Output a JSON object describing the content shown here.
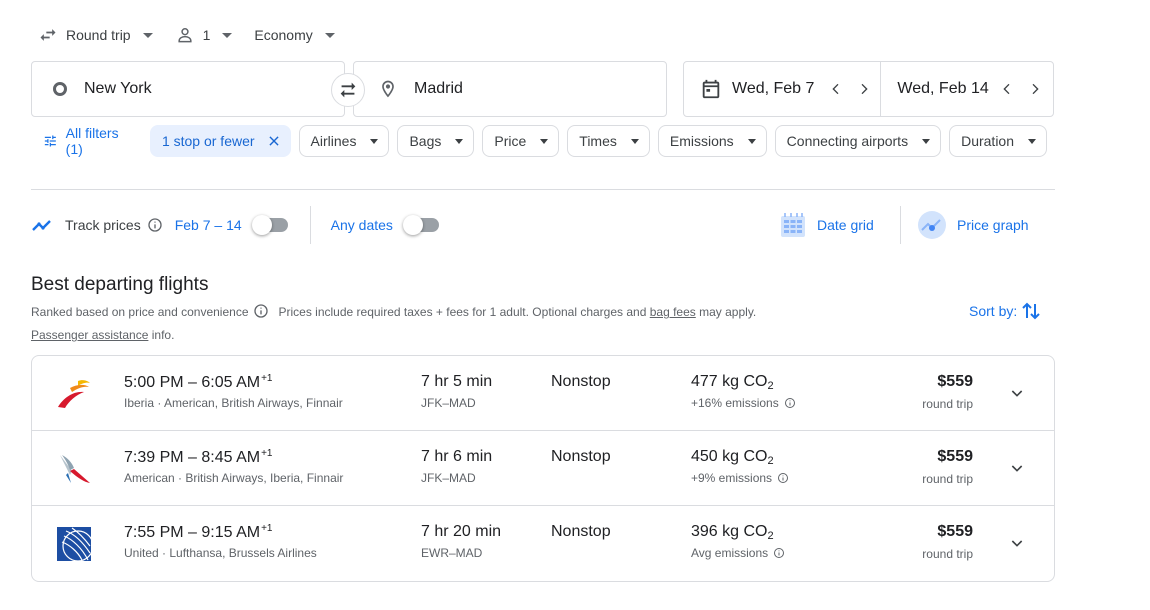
{
  "top": {
    "trip_type": "Round trip",
    "passengers": "1",
    "cabin": "Economy"
  },
  "search": {
    "origin": "New York",
    "destination": "Madrid",
    "depart_date": "Wed, Feb 7",
    "return_date": "Wed, Feb 14"
  },
  "filters": {
    "all_filters": "All filters (1)",
    "active_chip": "1 stop or fewer",
    "chips": [
      "Airlines",
      "Bags",
      "Price",
      "Times",
      "Emissions",
      "Connecting airports",
      "Duration"
    ]
  },
  "track": {
    "label": "Track prices",
    "dates": "Feb 7 – 14",
    "any_dates": "Any dates",
    "date_grid": "Date grid",
    "price_graph": "Price graph"
  },
  "results": {
    "title": "Best departing flights",
    "ranked": "Ranked based on price and convenience",
    "prices_note": "Prices include required taxes + fees for 1 adult. Optional charges and",
    "bag_fees": "bag fees",
    "may_apply": "may apply.",
    "passenger_assistance": "Passenger assistance",
    "info": "info.",
    "sort_by": "Sort by:"
  },
  "flights": [
    {
      "depart": "5:00 PM",
      "arrive": "6:05 AM",
      "day_offset": "+1",
      "airlines": "Iberia · American, British Airways, Finnair",
      "duration": "7 hr 5 min",
      "route": "JFK–MAD",
      "stops": "Nonstop",
      "co2": "477 kg CO",
      "co2_sub": "2",
      "emissions": "+16% emissions",
      "price": "$559",
      "price_type": "round trip",
      "logo": "iberia-logo"
    },
    {
      "depart": "7:39 PM",
      "arrive": "8:45 AM",
      "day_offset": "+1",
      "airlines": "American · British Airways, Iberia, Finnair",
      "duration": "7 hr 6 min",
      "route": "JFK–MAD",
      "stops": "Nonstop",
      "co2": "450 kg CO",
      "co2_sub": "2",
      "emissions": "+9% emissions",
      "price": "$559",
      "price_type": "round trip",
      "logo": "american-airlines-logo"
    },
    {
      "depart": "7:55 PM",
      "arrive": "9:15 AM",
      "day_offset": "+1",
      "airlines": "United · Lufthansa, Brussels Airlines",
      "duration": "7 hr 20 min",
      "route": "EWR–MAD",
      "stops": "Nonstop",
      "co2": "396 kg CO",
      "co2_sub": "2",
      "emissions": "Avg emissions",
      "price": "$559",
      "price_type": "round trip",
      "logo": "united-logo"
    }
  ],
  "colors": {
    "accent": "#1a73e8",
    "chip_active_bg": "#e8f0fe",
    "border": "#dadce0",
    "text_secondary": "#5f6368"
  }
}
